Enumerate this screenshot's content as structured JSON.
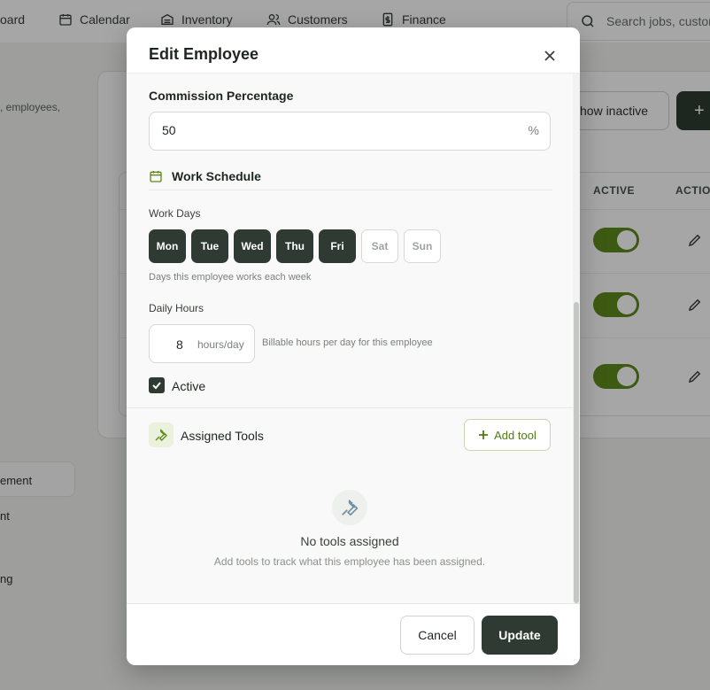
{
  "nav": {
    "items": [
      {
        "label": "oard",
        "icon": "none"
      },
      {
        "label": "Calendar",
        "icon": "calendar-icon"
      },
      {
        "label": "Inventory",
        "icon": "inventory-icon"
      },
      {
        "label": "Customers",
        "icon": "users-icon"
      },
      {
        "label": "Finance",
        "icon": "finance-icon"
      }
    ],
    "search_placeholder": "Search jobs, custon"
  },
  "background": {
    "subtitle": ", employees,",
    "show_inactive_label": "how inactive",
    "add_label": "+",
    "columns": {
      "active": "ACTIVE",
      "actions": "ACTIO"
    },
    "sidebar": [
      "ement",
      "nt",
      "ng"
    ]
  },
  "modal": {
    "title": "Edit Employee",
    "commission": {
      "label": "Commission Percentage",
      "value": "50",
      "suffix": "%"
    },
    "schedule": {
      "heading": "Work Schedule",
      "work_days_label": "Work Days",
      "days": [
        {
          "label": "Mon",
          "active": true
        },
        {
          "label": "Tue",
          "active": true
        },
        {
          "label": "Wed",
          "active": true
        },
        {
          "label": "Thu",
          "active": true
        },
        {
          "label": "Fri",
          "active": true
        },
        {
          "label": "Sat",
          "active": false
        },
        {
          "label": "Sun",
          "active": false
        }
      ],
      "days_hint": "Days this employee works each week",
      "daily_hours_label": "Daily Hours",
      "hours_value": "8",
      "hours_unit": "hours/day",
      "hours_hint": "Billable hours per day for this employee"
    },
    "active_label": "Active",
    "tools": {
      "title": "Assigned Tools",
      "add_label": "Add tool",
      "empty_title": "No tools assigned",
      "empty_subtitle": "Add tools to track what this employee has been assigned."
    },
    "footer": {
      "cancel_label": "Cancel",
      "update_label": "Update"
    }
  },
  "colors": {
    "accent": "#5f8a1c",
    "dark": "#2f3b32"
  }
}
